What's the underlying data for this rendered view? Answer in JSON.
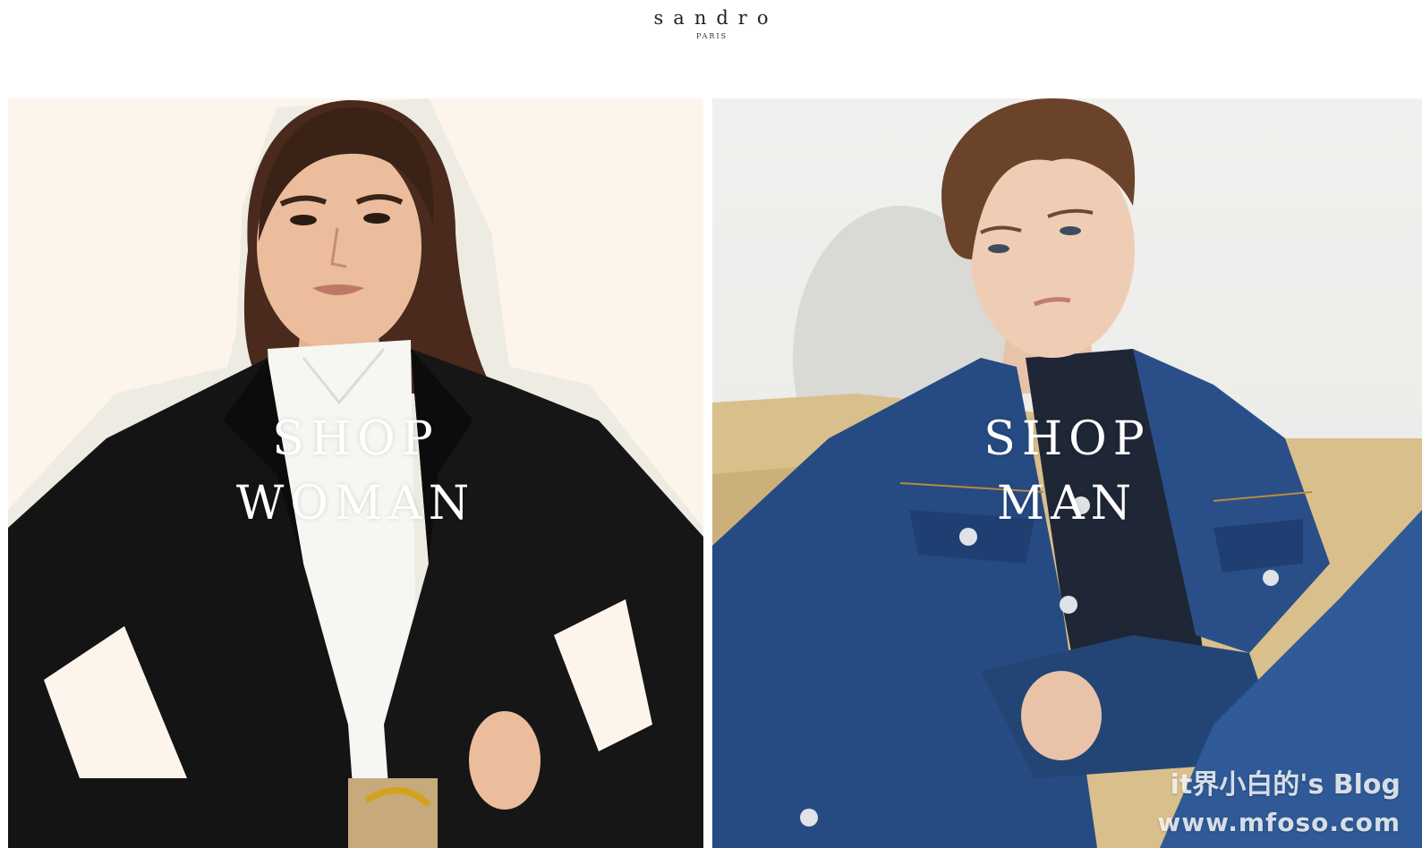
{
  "header": {
    "brand": "sandro",
    "brand_sub": "PARIS"
  },
  "panels": [
    {
      "id": "woman",
      "line1": "SHOP",
      "line2": "WOMAN",
      "background": "#fdf5ec"
    },
    {
      "id": "man",
      "line1": "SHOP",
      "line2": "MAN",
      "background": "#ecebe8"
    }
  ],
  "watermark": {
    "line1": "it界小白的's Blog",
    "line2": "www.mfoso.com"
  },
  "colors": {
    "blazer": "#141414",
    "shirt": "#f6f6f2",
    "denim": "#264a82",
    "sofa": "#d9bf8c"
  }
}
